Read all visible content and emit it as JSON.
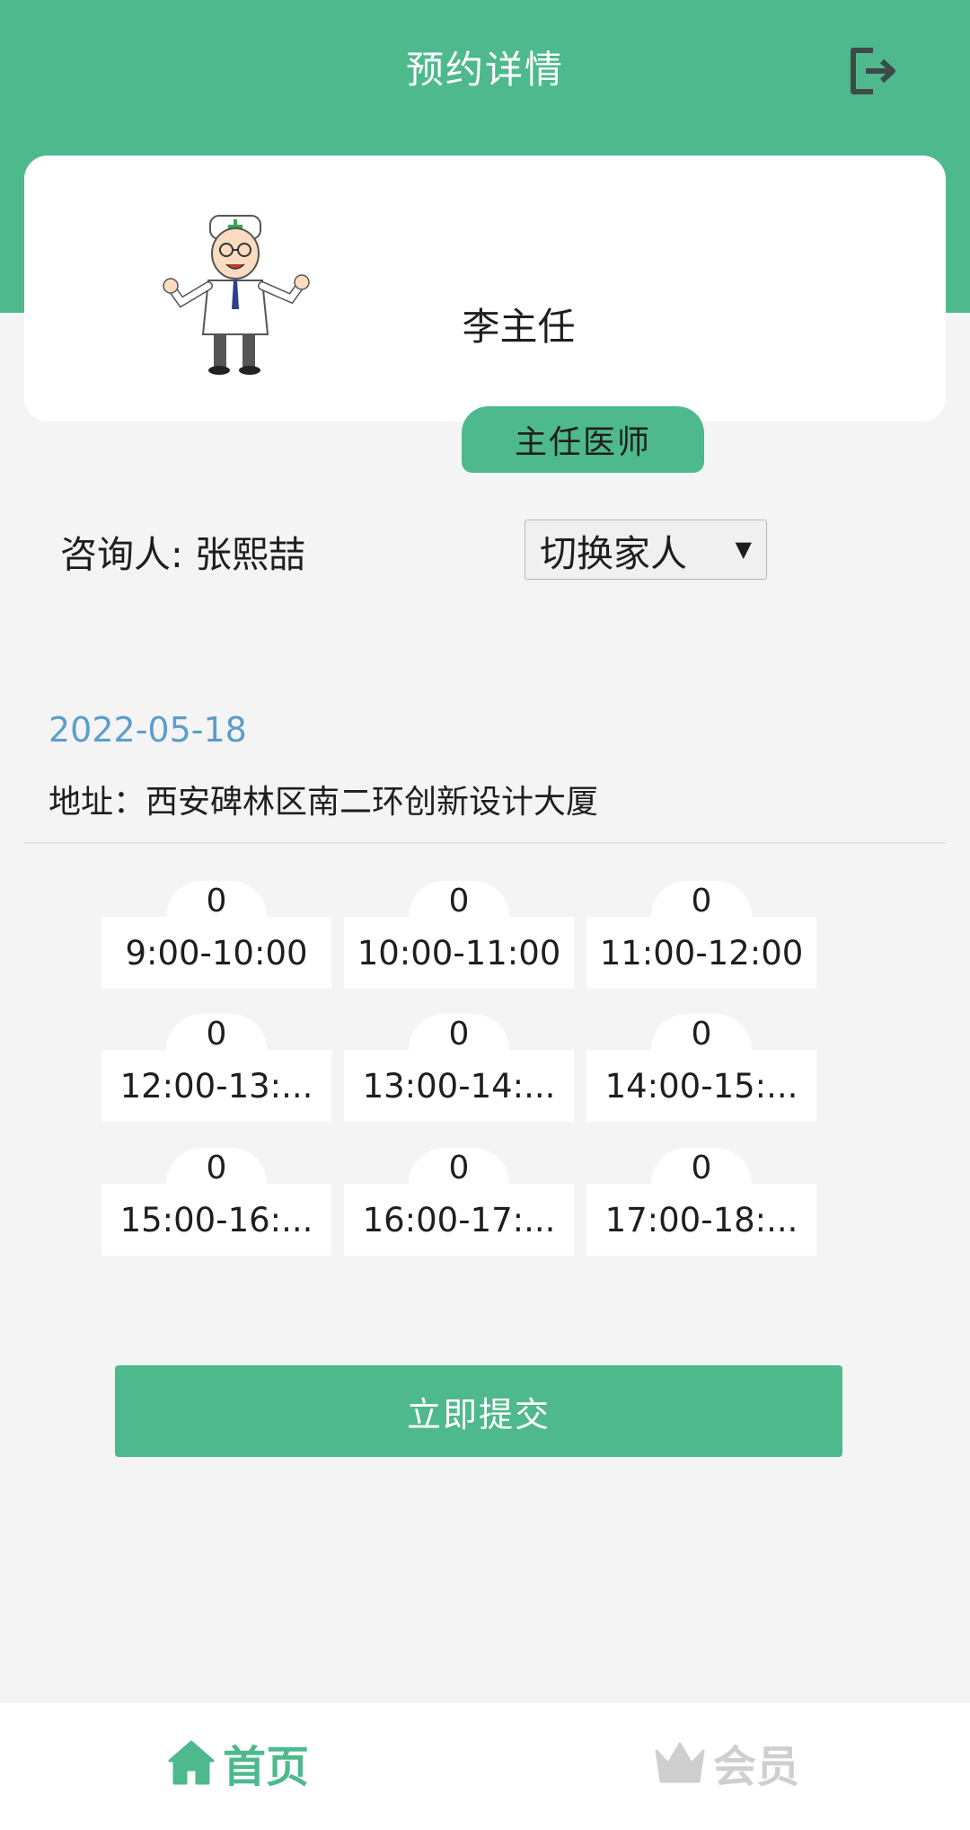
{
  "header": {
    "title": "预约详情"
  },
  "doctor": {
    "name": "李主任",
    "title_badge": "主任医师"
  },
  "consultant": {
    "label": "咨询人: 张熙喆",
    "switch_select": "切换家人"
  },
  "appointment": {
    "date": "2022-05-18",
    "address": "地址：西安碑林区南二环创新设计大厦"
  },
  "slots": [
    {
      "count": "0",
      "time": "9:00-10:00"
    },
    {
      "count": "0",
      "time": "10:00-11:00"
    },
    {
      "count": "0",
      "time": "11:00-12:00"
    },
    {
      "count": "0",
      "time": "12:00-13:..."
    },
    {
      "count": "0",
      "time": "13:00-14:..."
    },
    {
      "count": "0",
      "time": "14:00-15:..."
    },
    {
      "count": "0",
      "time": "15:00-16:..."
    },
    {
      "count": "0",
      "time": "16:00-17:..."
    },
    {
      "count": "0",
      "time": "17:00-18:..."
    }
  ],
  "submit_label": "立即提交",
  "tabbar": {
    "home_label": "首页",
    "vip_label": "会员"
  },
  "colors": {
    "accent": "#4eb98c",
    "date_blue": "#5b9ecb",
    "inactive": "#cfcfcf"
  }
}
